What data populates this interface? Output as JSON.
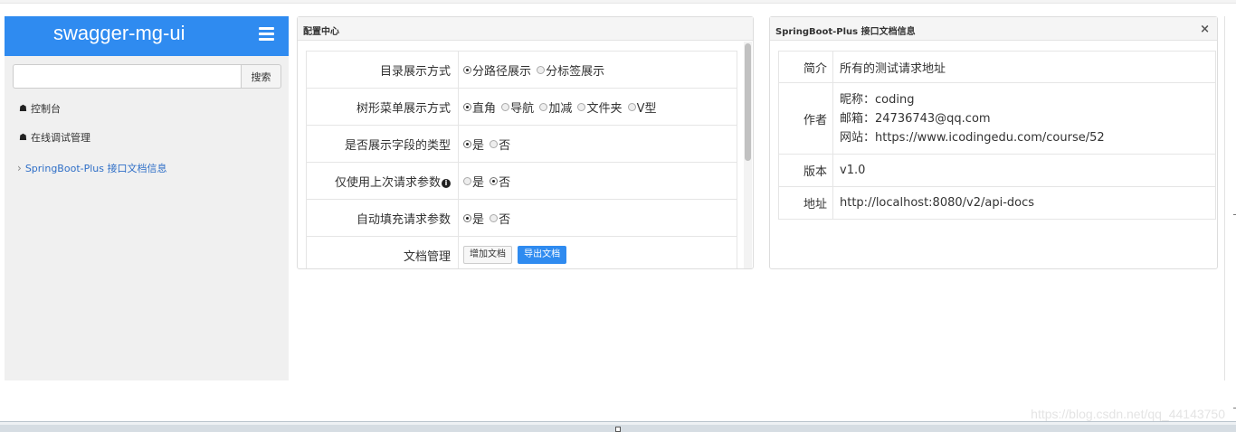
{
  "sidebar": {
    "brand": "swagger-mg-ui",
    "search_button": "搜索",
    "search_value": "",
    "items": [
      {
        "label": "控制台",
        "icon": "home-icon"
      },
      {
        "label": "在线调试管理",
        "icon": "home-icon"
      },
      {
        "label": "SpringBoot-Plus 接口文档信息",
        "icon": "chevron-right-icon"
      }
    ]
  },
  "config": {
    "title": "配置中心",
    "rows": [
      {
        "label": "目录展示方式",
        "options": [
          "分路径展示",
          "分标签展示"
        ],
        "selected": 0
      },
      {
        "label": "树形菜单展示方式",
        "options": [
          "直角",
          "导航",
          "加减",
          "文件夹",
          "V型"
        ],
        "selected": 0
      },
      {
        "label": "是否展示字段的类型",
        "options": [
          "是",
          "否"
        ],
        "selected": 0
      },
      {
        "label": "仅使用上次请求参数",
        "options": [
          "是",
          "否"
        ],
        "selected": 1
      },
      {
        "label": "自动填充请求参数",
        "options": [
          "是",
          "否"
        ],
        "selected": 0
      },
      {
        "label": "文档管理"
      }
    ],
    "add_doc": "增加文档",
    "export_doc": "导出文档"
  },
  "doc": {
    "title": "SpringBoot-Plus 接口文档信息",
    "close": "×",
    "intro_label": "简介",
    "intro_value": "所有的测试请求地址",
    "author_label": "作者",
    "author_nick": "昵称：coding",
    "author_email": "邮箱：24736743@qq.com",
    "author_site": "网站：https://www.icodingedu.com/course/52",
    "version_label": "版本",
    "version_value": "v1.0",
    "address_label": "地址",
    "address_value": "http://localhost:8080/v2/api-docs"
  },
  "watermark": "https://blog.csdn.net/qq_44143750"
}
